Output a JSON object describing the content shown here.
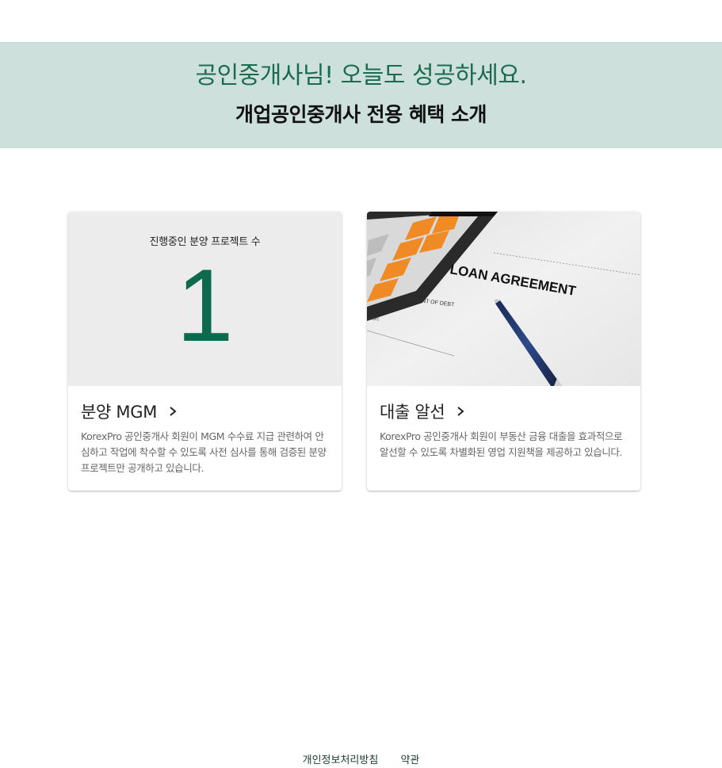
{
  "banner": {
    "greeting": "공인중개사님! 오늘도 성공하세요.",
    "subtitle": "개업공인중개사 전용 혜택 소개"
  },
  "cards": [
    {
      "stat_label": "진행중인 분양 프로젝트 수",
      "stat_value": "1",
      "title": "분양 MGM",
      "description": "KorexPro 공인중개사 회원이 MGM 수수료 지급 관련하여 안심하고 작업에 착수할 수 있도록 사전 심사를 통해 검증된 분양 프로젝트만 공개하고 있습니다."
    },
    {
      "image_text": "LOAN AGREEMENT",
      "image_subtext": "AMOUNT OF DEBT",
      "title": "대출 알선",
      "description": "KorexPro 공인중개사 회원이 부동산 금융 대출을 효과적으로 알선할 수 있도록 차별화된 영업 지원책을 제공하고 있습니다."
    }
  ],
  "footer": {
    "privacy": "개인정보처리방침",
    "terms": "약관"
  },
  "colors": {
    "banner_bg": "#cde0db",
    "accent_green": "#1b6b4f",
    "stat_green": "#0e6a4c"
  }
}
